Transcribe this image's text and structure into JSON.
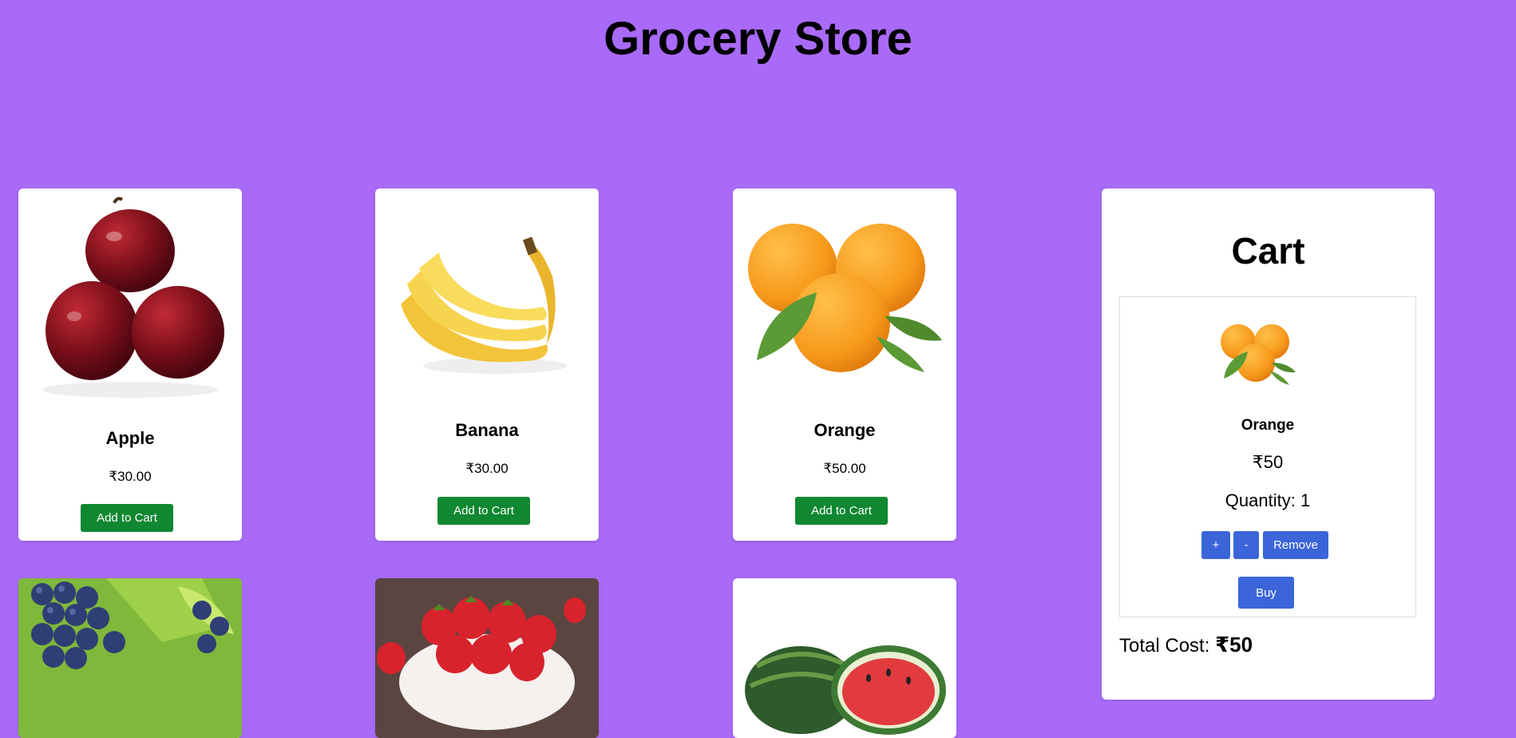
{
  "header": {
    "title": "Grocery Store"
  },
  "products": [
    {
      "name": "Apple",
      "price": "₹30.00",
      "button": "Add to Cart",
      "icon": "apple-image"
    },
    {
      "name": "Banana",
      "price": "₹30.00",
      "button": "Add to Cart",
      "icon": "banana-image"
    },
    {
      "name": "Orange",
      "price": "₹50.00",
      "button": "Add to Cart",
      "icon": "orange-image"
    },
    {
      "name": "",
      "price": "",
      "button": "",
      "icon": "grapes-image"
    },
    {
      "name": "",
      "price": "",
      "button": "",
      "icon": "strawberry-image"
    },
    {
      "name": "",
      "price": "",
      "button": "",
      "icon": "watermelon-image"
    }
  ],
  "cart": {
    "title": "Cart",
    "item": {
      "name": "Orange",
      "price": "₹50",
      "quantity": "Quantity: 1",
      "plus": "+",
      "minus": "-",
      "remove": "Remove",
      "buy": "Buy"
    },
    "total_label": "Total Cost:",
    "total_value": "₹50"
  },
  "colors": {
    "background": "#a96af8",
    "add_button": "#108731",
    "cart_button": "#3b65d8"
  }
}
